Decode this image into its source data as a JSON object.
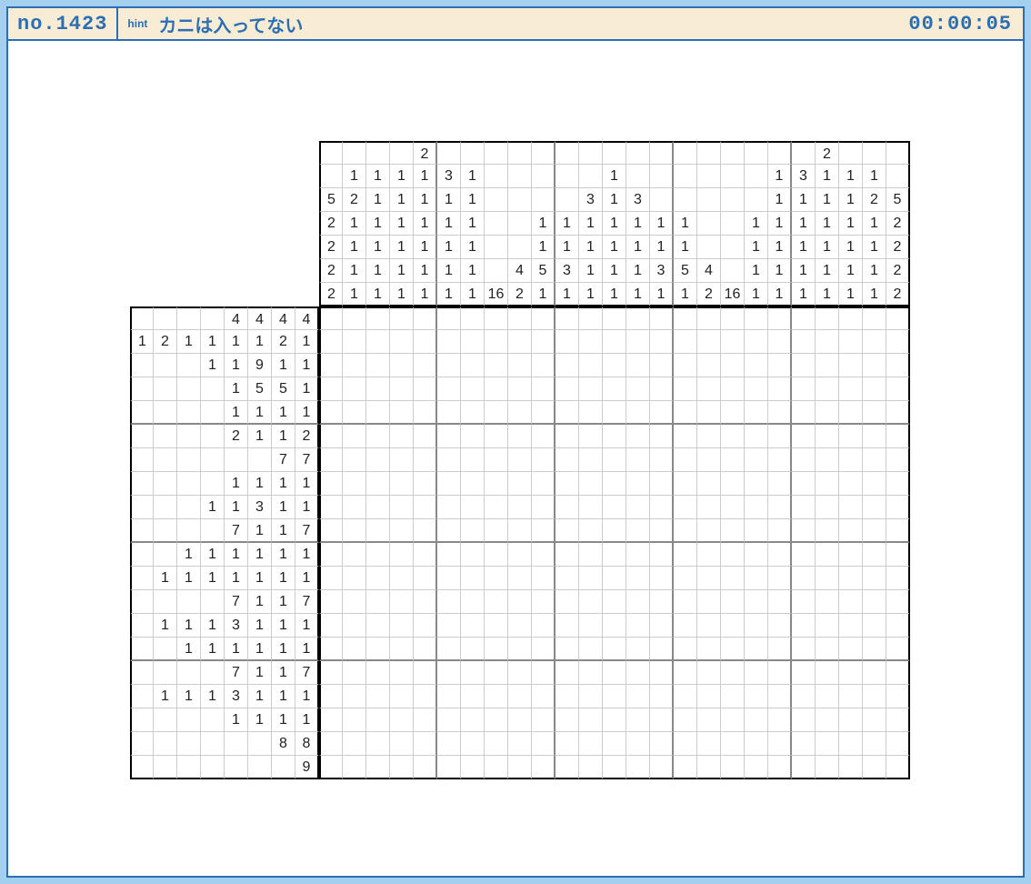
{
  "header": {
    "no_label": "no.1423",
    "hint_label": "hint",
    "hint_text": "カニは入ってない",
    "timer": "00:00:05"
  },
  "puzzle": {
    "grid_cols": 25,
    "grid_rows": 20,
    "row_clue_cols": 8,
    "col_clue_rows": 7,
    "col_clues": [
      [
        "",
        "",
        "5",
        "2",
        "2",
        "2",
        "2"
      ],
      [
        "",
        "1",
        "2",
        "1",
        "1",
        "1",
        "1"
      ],
      [
        "",
        "1",
        "1",
        "1",
        "1",
        "1",
        "1"
      ],
      [
        "",
        "1",
        "1",
        "1",
        "1",
        "1",
        "1"
      ],
      [
        "2",
        "1",
        "1",
        "1",
        "1",
        "1",
        "1"
      ],
      [
        "",
        "3",
        "1",
        "1",
        "1",
        "1",
        "1"
      ],
      [
        "",
        "1",
        "1",
        "1",
        "1",
        "1",
        "1"
      ],
      [
        "",
        "",
        "",
        "",
        "",
        "",
        "16"
      ],
      [
        "",
        "",
        "",
        "",
        "",
        "4",
        "2"
      ],
      [
        "",
        "",
        "",
        "1",
        "1",
        "5",
        "1"
      ],
      [
        "",
        "",
        "",
        "1",
        "1",
        "3",
        "1"
      ],
      [
        "",
        "",
        "3",
        "1",
        "1",
        "1",
        "1"
      ],
      [
        "",
        "1",
        "1",
        "1",
        "1",
        "1",
        "1"
      ],
      [
        "",
        "",
        "3",
        "1",
        "1",
        "1",
        "1"
      ],
      [
        "",
        "",
        "",
        "1",
        "1",
        "3",
        "1"
      ],
      [
        "",
        "",
        "",
        "1",
        "1",
        "5",
        "1"
      ],
      [
        "",
        "",
        "",
        "",
        "",
        "4",
        "2"
      ],
      [
        "",
        "",
        "",
        "",
        "",
        "",
        "16"
      ],
      [
        "",
        "",
        "",
        "1",
        "1",
        "1",
        "1"
      ],
      [
        "",
        "1",
        "1",
        "1",
        "1",
        "1",
        "1"
      ],
      [
        "",
        "3",
        "1",
        "1",
        "1",
        "1",
        "1"
      ],
      [
        "2",
        "1",
        "1",
        "1",
        "1",
        "1",
        "1"
      ],
      [
        "",
        "1",
        "1",
        "1",
        "1",
        "1",
        "1"
      ],
      [
        "",
        "1",
        "2",
        "1",
        "1",
        "1",
        "1"
      ],
      [
        "",
        "",
        "5",
        "2",
        "2",
        "2",
        "2"
      ]
    ],
    "row_clues": [
      [
        "",
        "",
        "",
        "",
        "4",
        "4",
        "4",
        "4"
      ],
      [
        "1",
        "2",
        "1",
        "1",
        "1",
        "1",
        "2",
        "1"
      ],
      [
        "",
        "",
        "1",
        "1",
        "9",
        "1",
        "1",
        ""
      ],
      [
        "",
        "",
        "",
        "1",
        "5",
        "5",
        "1",
        ""
      ],
      [
        "",
        "",
        "",
        "1",
        "1",
        "1",
        "1",
        ""
      ],
      [
        "",
        "",
        "",
        "2",
        "1",
        "1",
        "2",
        ""
      ],
      [
        "",
        "",
        "",
        "",
        "",
        "7",
        "7",
        ""
      ],
      [
        "",
        "",
        "",
        "1",
        "1",
        "1",
        "1",
        ""
      ],
      [
        "",
        "",
        "1",
        "1",
        "3",
        "1",
        "1",
        ""
      ],
      [
        "",
        "",
        "",
        "7",
        "1",
        "1",
        "7",
        ""
      ],
      [
        "",
        "",
        "1",
        "1",
        "1",
        "1",
        "1",
        "1"
      ],
      [
        "",
        "1",
        "1",
        "1",
        "1",
        "1",
        "1",
        "1"
      ],
      [
        "",
        "",
        "",
        "7",
        "1",
        "1",
        "7",
        ""
      ],
      [
        "",
        "1",
        "1",
        "1",
        "3",
        "1",
        "1",
        "1"
      ],
      [
        "",
        "",
        "1",
        "1",
        "1",
        "1",
        "1",
        "1"
      ],
      [
        "",
        "",
        "",
        "7",
        "1",
        "1",
        "7",
        ""
      ],
      [
        "",
        "1",
        "1",
        "1",
        "3",
        "1",
        "1",
        "1"
      ],
      [
        "",
        "",
        "",
        "1",
        "1",
        "1",
        "1",
        ""
      ],
      [
        "",
        "",
        "",
        "",
        "",
        "8",
        "8",
        ""
      ],
      [
        "",
        "",
        "",
        "",
        "",
        "",
        "9",
        ""
      ]
    ]
  }
}
